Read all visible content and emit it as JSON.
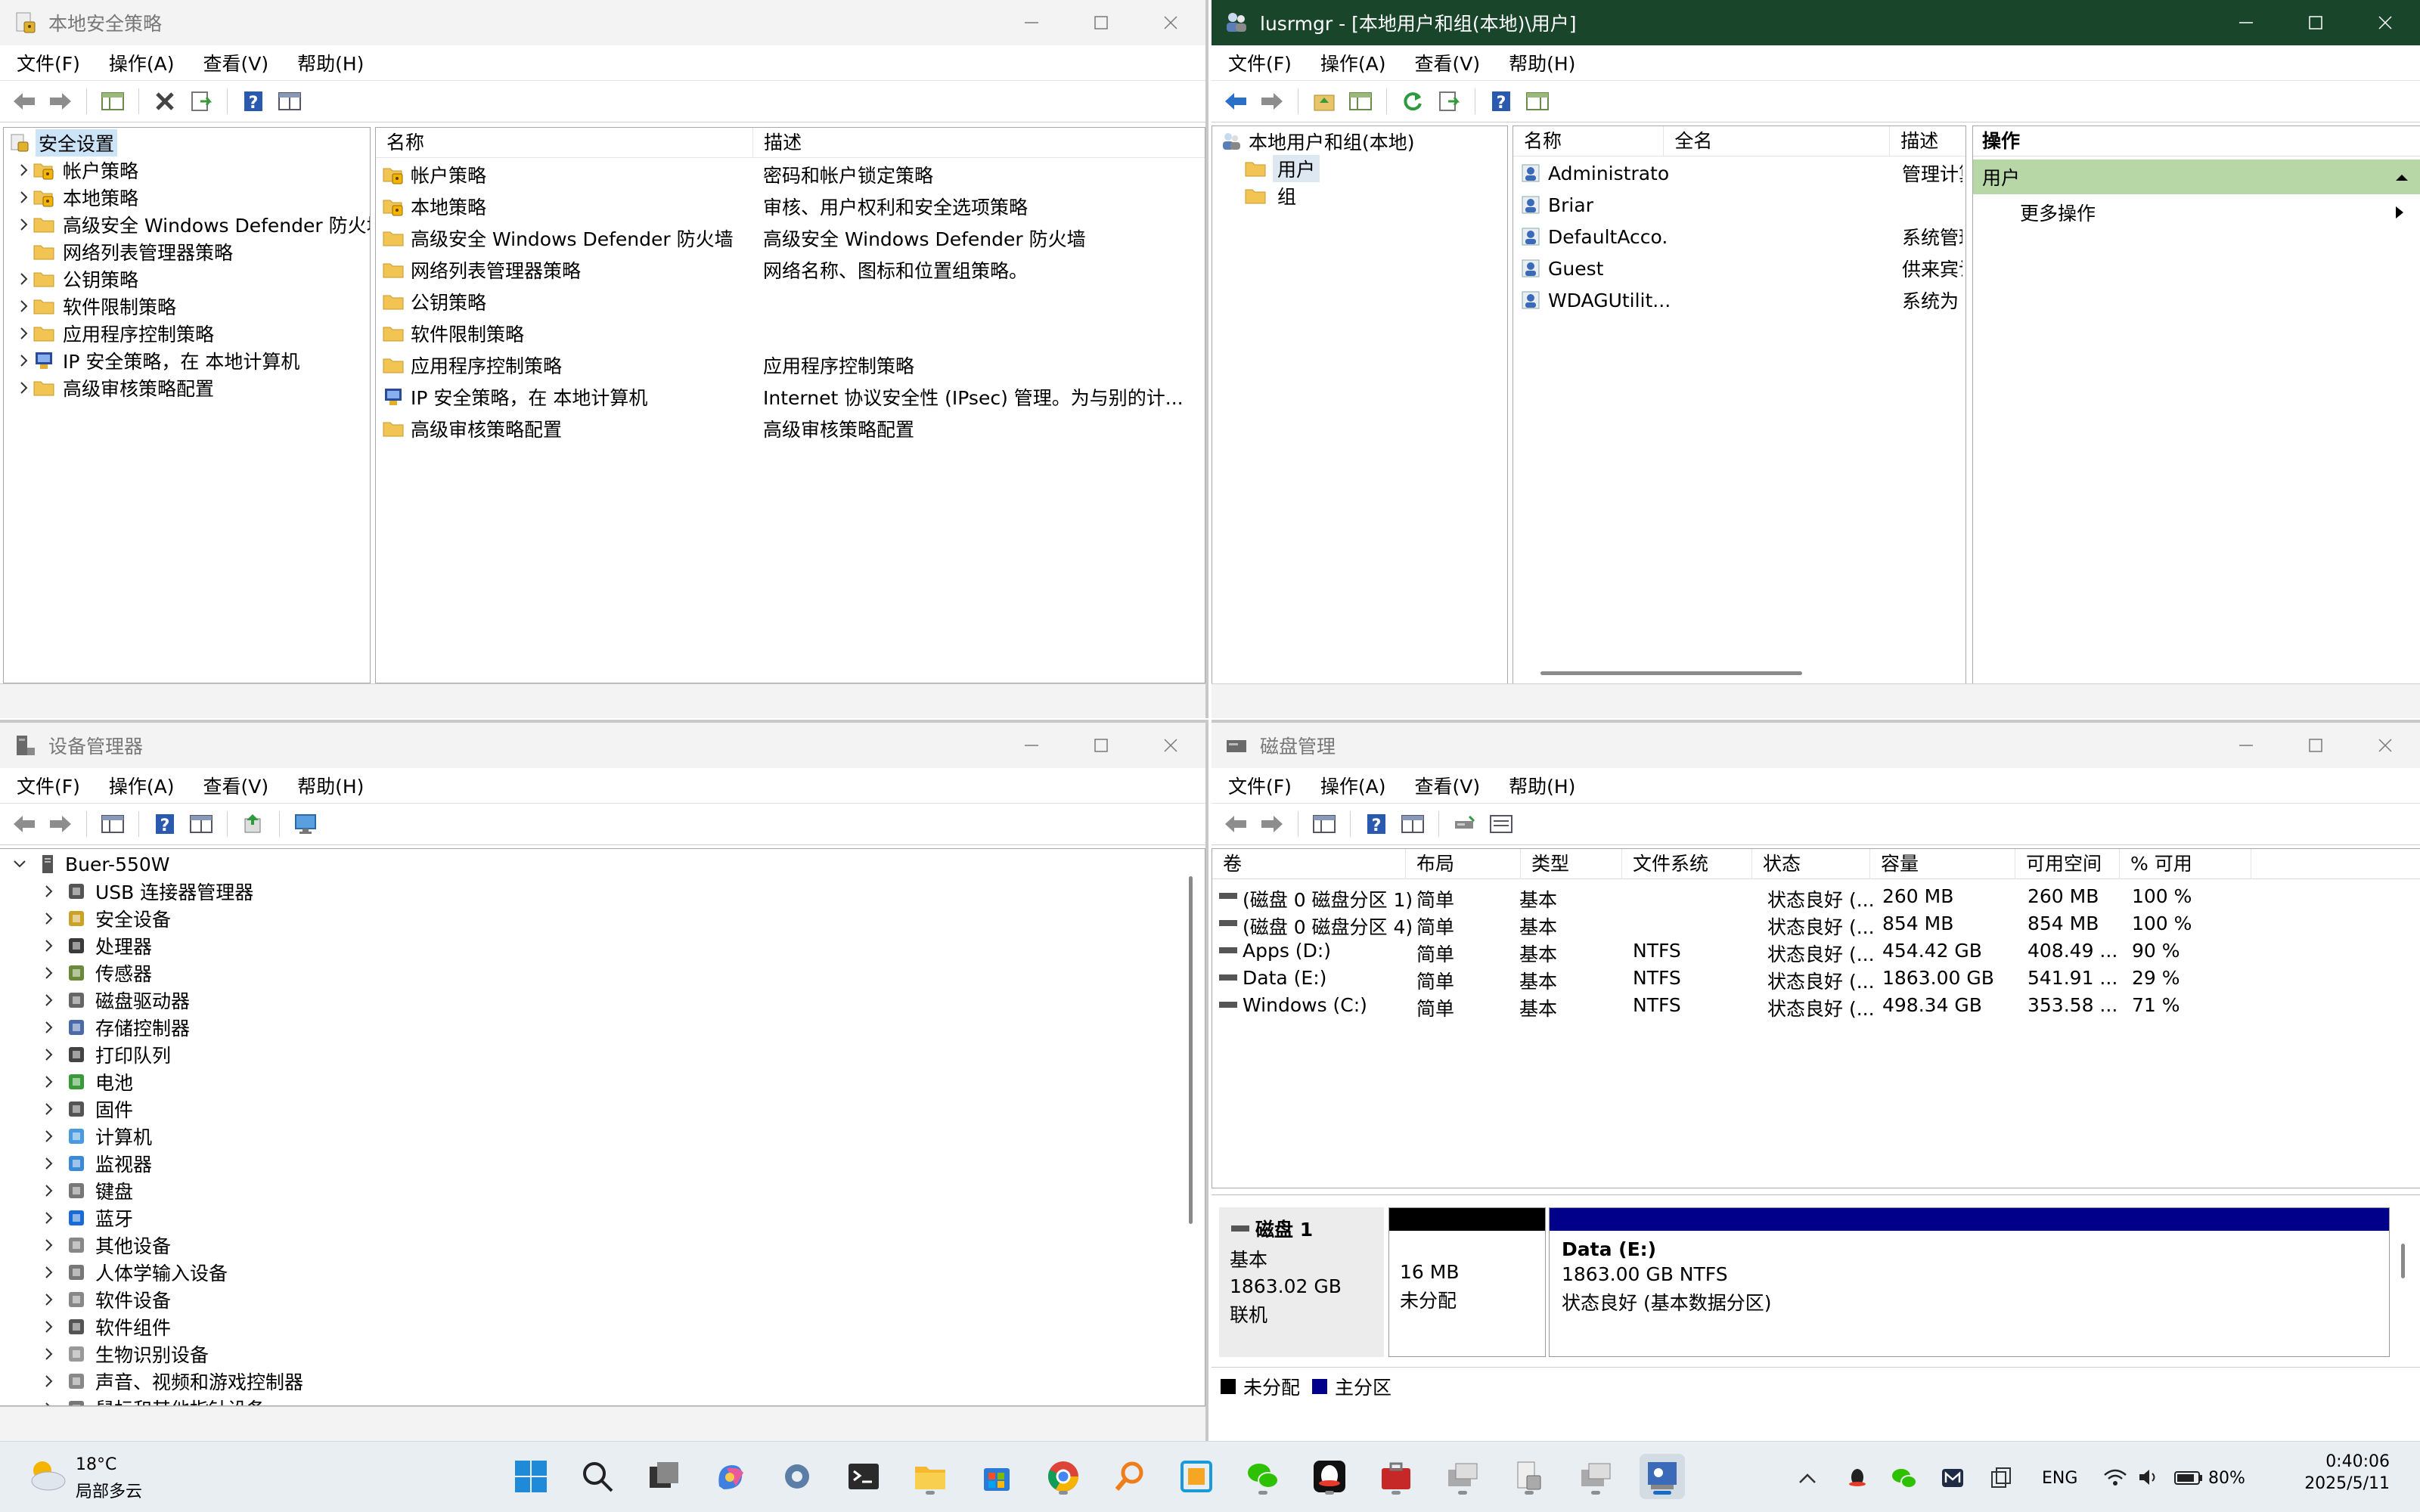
{
  "secpol": {
    "title": "本地安全策略",
    "menus": [
      "文件(F)",
      "操作(A)",
      "查看(V)",
      "帮助(H)"
    ],
    "tree_root": "安全设置",
    "tree": [
      "帐户策略",
      "本地策略",
      "高级安全 Windows Defender 防火墙",
      "网络列表管理器策略",
      "公钥策略",
      "软件限制策略",
      "应用程序控制策略",
      "IP 安全策略，在 本地计算机",
      "高级审核策略配置"
    ],
    "col_name": "名称",
    "col_desc": "描述",
    "items": [
      {
        "name": "帐户策略",
        "desc": "密码和帐户锁定策略"
      },
      {
        "name": "本地策略",
        "desc": "审核、用户权利和安全选项策略"
      },
      {
        "name": "高级安全 Windows Defender 防火墙",
        "desc": "高级安全 Windows Defender 防火墙"
      },
      {
        "name": "网络列表管理器策略",
        "desc": "网络名称、图标和位置组策略。"
      },
      {
        "name": "公钥策略",
        "desc": ""
      },
      {
        "name": "软件限制策略",
        "desc": ""
      },
      {
        "name": "应用程序控制策略",
        "desc": "应用程序控制策略"
      },
      {
        "name": "IP 安全策略，在 本地计算机",
        "desc": "Internet 协议安全性 (IPsec) 管理。为与别的计..."
      },
      {
        "name": "高级审核策略配置",
        "desc": "高级审核策略配置"
      }
    ]
  },
  "lusrmgr": {
    "title": "lusrmgr - [本地用户和组(本地)\\用户]",
    "menus": [
      "文件(F)",
      "操作(A)",
      "查看(V)",
      "帮助(H)"
    ],
    "tree_root": "本地用户和组(本地)",
    "tree": [
      "用户",
      "组"
    ],
    "cols": [
      "名称",
      "全名",
      "描述"
    ],
    "users": [
      {
        "name": "Administrator",
        "fullname": "",
        "desc": "管理计算"
      },
      {
        "name": "Briar",
        "fullname": "",
        "desc": ""
      },
      {
        "name": "DefaultAcco...",
        "fullname": "",
        "desc": "系统管理"
      },
      {
        "name": "Guest",
        "fullname": "",
        "desc": "供来宾访"
      },
      {
        "name": "WDAGUtilit...",
        "fullname": "",
        "desc": "系统为 W"
      }
    ],
    "actions_header": "操作",
    "actions_section": "用户",
    "actions_more": "更多操作"
  },
  "devmgmt": {
    "title": "设备管理器",
    "menus": [
      "文件(F)",
      "操作(A)",
      "查看(V)",
      "帮助(H)"
    ],
    "root": "Buer-550W",
    "categories": [
      "USB 连接器管理器",
      "安全设备",
      "处理器",
      "传感器",
      "磁盘驱动器",
      "存储控制器",
      "打印队列",
      "电池",
      "固件",
      "计算机",
      "监视器",
      "键盘",
      "蓝牙",
      "其他设备",
      "人体学输入设备",
      "软件设备",
      "软件组件",
      "生物识别设备",
      "声音、视频和游戏控制器",
      "鼠标和其他指针设备"
    ]
  },
  "diskmgmt": {
    "title": "磁盘管理",
    "menus": [
      "文件(F)",
      "操作(A)",
      "查看(V)",
      "帮助(H)"
    ],
    "cols": [
      "卷",
      "布局",
      "类型",
      "文件系统",
      "状态",
      "容量",
      "可用空间",
      "% 可用"
    ],
    "volumes": [
      {
        "vol": "(磁盘 0 磁盘分区 1)",
        "layout": "简单",
        "type": "基本",
        "fs": "",
        "status": "状态良好 (...",
        "cap": "260 MB",
        "free": "260 MB",
        "pct": "100 %"
      },
      {
        "vol": "(磁盘 0 磁盘分区 4)",
        "layout": "简单",
        "type": "基本",
        "fs": "",
        "status": "状态良好 (...",
        "cap": "854 MB",
        "free": "854 MB",
        "pct": "100 %"
      },
      {
        "vol": "Apps (D:)",
        "layout": "简单",
        "type": "基本",
        "fs": "NTFS",
        "status": "状态良好 (...",
        "cap": "454.42 GB",
        "free": "408.49 ...",
        "pct": "90 %"
      },
      {
        "vol": "Data (E:)",
        "layout": "简单",
        "type": "基本",
        "fs": "NTFS",
        "status": "状态良好 (...",
        "cap": "1863.00 GB",
        "free": "541.91 ...",
        "pct": "29 %"
      },
      {
        "vol": "Windows (C:)",
        "layout": "简单",
        "type": "基本",
        "fs": "NTFS",
        "status": "状态良好 (...",
        "cap": "498.34 GB",
        "free": "353.58 ...",
        "pct": "71 %"
      }
    ],
    "disk": {
      "name": "磁盘 1",
      "type": "基本",
      "size": "1863.02 GB",
      "state": "联机"
    },
    "unalloc": {
      "size": "16 MB",
      "label": "未分配"
    },
    "part": {
      "name": "Data  (E:)",
      "size": "1863.00 GB NTFS",
      "status": "状态良好 (基本数据分区)"
    },
    "legend_unalloc": "未分配",
    "legend_primary": "主分区",
    "colors": {
      "unalloc": "#000000",
      "primary": "#00008b"
    }
  },
  "taskbar": {
    "temp": "18°C",
    "weather": "局部多云",
    "lang": "ENG",
    "battery": "80%",
    "time": "0:40:06",
    "date": "2025/5/11",
    "apps": [
      "start-icon",
      "search-icon",
      "task-view-icon",
      "copilot-icon",
      "settings-icon",
      "terminal-icon",
      "file-explorer-icon",
      "store-icon",
      "chrome-icon",
      "magnifier-icon",
      "app-icon",
      "wechat-icon",
      "qq-icon",
      "toolbox-icon",
      "remote-icon",
      "network-icon",
      "secpol-icon",
      "mmc-icon"
    ]
  }
}
